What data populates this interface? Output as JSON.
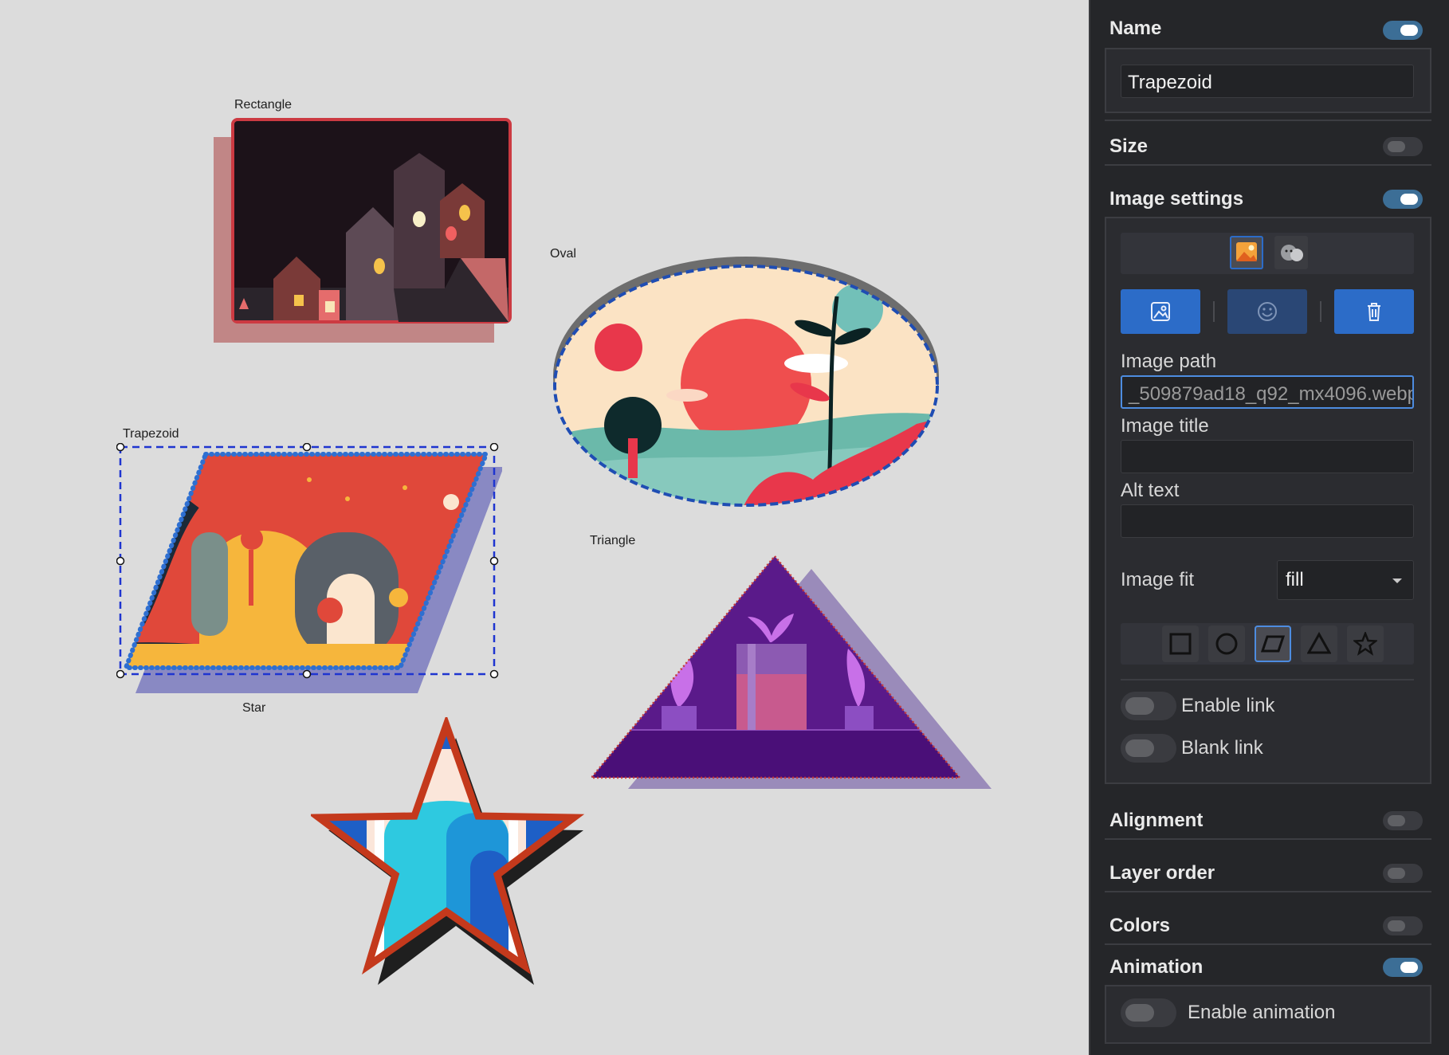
{
  "canvas": {
    "shapes": [
      {
        "label": "Rectangle"
      },
      {
        "label": "Oval"
      },
      {
        "label": "Trapezoid"
      },
      {
        "label": "Triangle"
      },
      {
        "label": "Star"
      }
    ]
  },
  "panel": {
    "name": {
      "heading": "Name",
      "value": "Trapezoid",
      "enabled": true
    },
    "size": {
      "heading": "Size",
      "enabled": false
    },
    "image_settings": {
      "heading": "Image settings",
      "enabled": true,
      "image_path_label": "Image path",
      "image_path_value": "_509879ad18_q92_mx4096.webp",
      "image_title_label": "Image title",
      "image_title_value": "",
      "alt_text_label": "Alt text",
      "alt_text_value": "",
      "image_fit_label": "Image fit",
      "image_fit_value": "fill",
      "mask_shapes": [
        "square",
        "circle",
        "trapezoid",
        "triangle",
        "star"
      ],
      "active_mask": "trapezoid",
      "enable_link_label": "Enable link",
      "blank_link_label": "Blank link"
    },
    "alignment": {
      "heading": "Alignment",
      "enabled": false
    },
    "layer_order": {
      "heading": "Layer order",
      "enabled": false
    },
    "colors": {
      "heading": "Colors",
      "enabled": false
    },
    "animation": {
      "heading": "Animation",
      "enabled": true,
      "enable_animation_label": "Enable animation"
    }
  },
  "colors": {
    "accent": "#4d8ce0",
    "toggle_on": "#3c6e96",
    "panel_bg": "#252629"
  }
}
